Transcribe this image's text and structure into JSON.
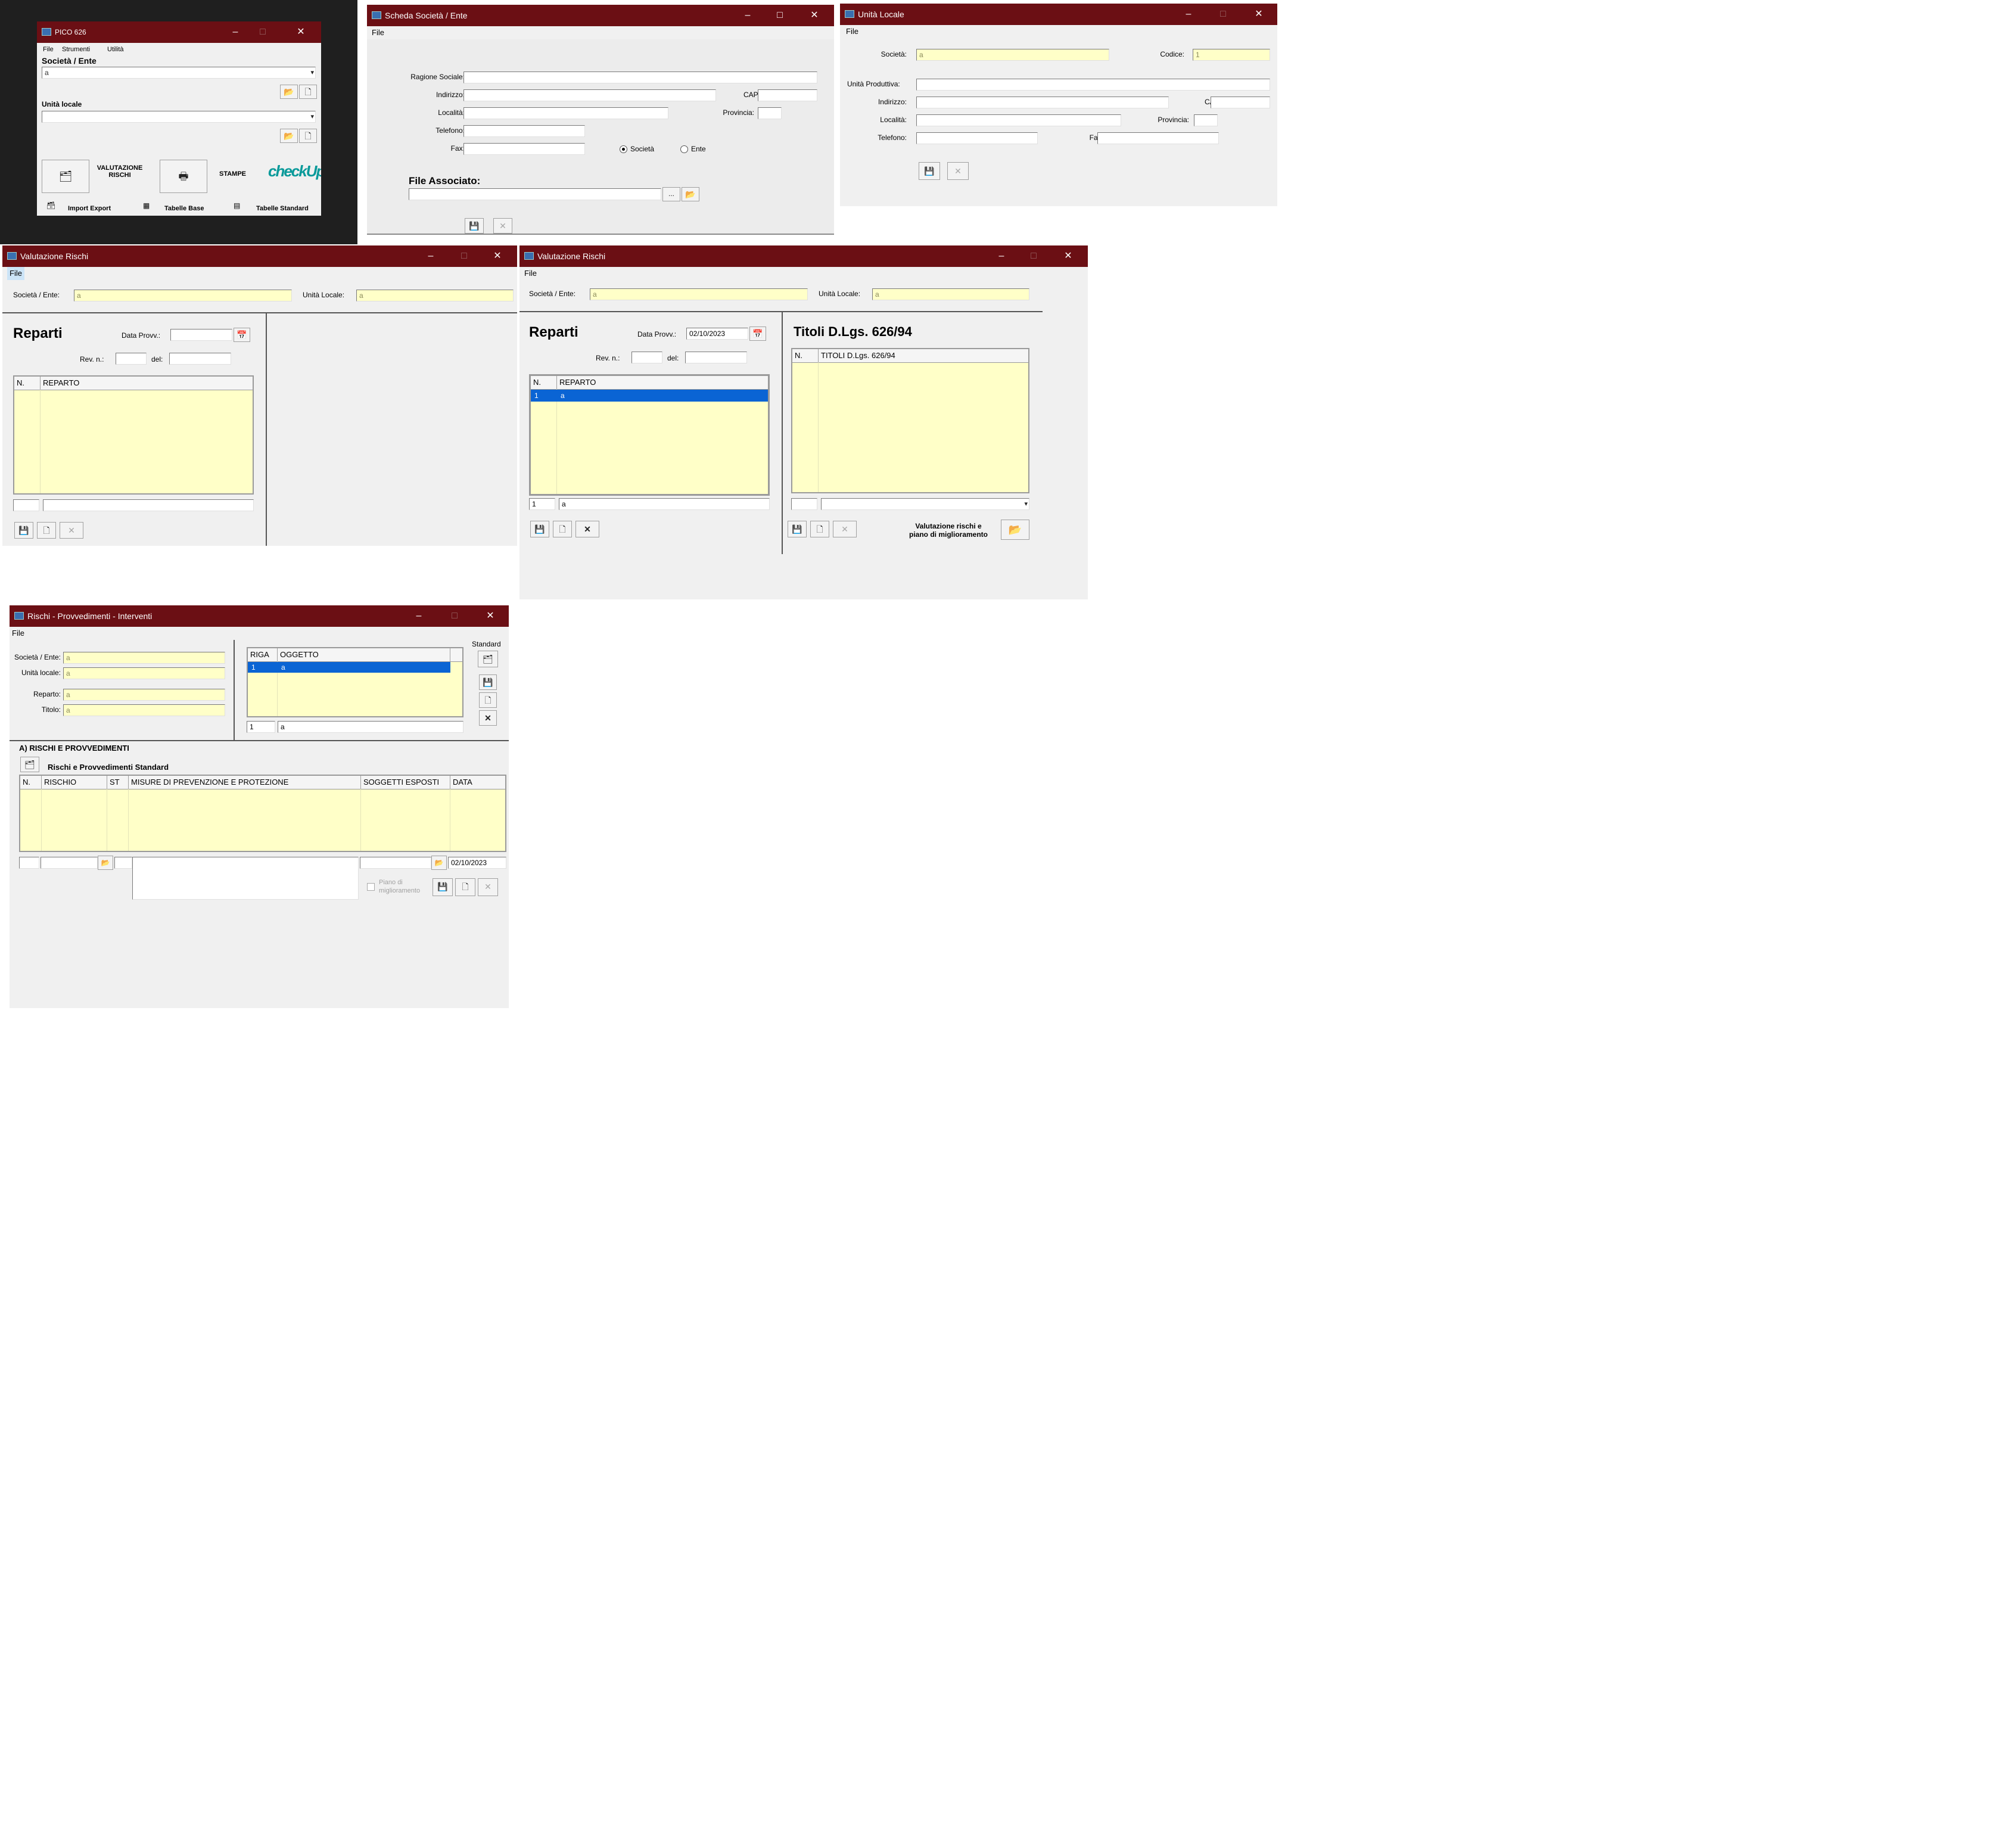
{
  "pico": {
    "title": "PICO 626",
    "menu": [
      "File",
      "Strumenti",
      "Utilità"
    ],
    "societa_label": "Società / Ente",
    "societa_value": "a",
    "unita_label": "Unità locale",
    "unita_value": "",
    "valutazione_label": "VALUTAZIONE\nRISCHI",
    "stampe_label": "STAMPE",
    "logo_text": "checkUp",
    "import_export": "Import Export",
    "tabelle_base": "Tabelle Base",
    "tabelle_standard": "Tabelle Standard"
  },
  "scheda": {
    "title": "Scheda Società / Ente",
    "menu": "File",
    "ragione_sociale": "Ragione Sociale:",
    "indirizzo": "Indirizzo:",
    "cap": "CAP:",
    "localita": "Località:",
    "provincia": "Provincia:",
    "telefono": "Telefono:",
    "fax": "Fax:",
    "radio_societa": "Società",
    "radio_ente": "Ente",
    "file_associato": "File Associato:",
    "browse": "..."
  },
  "unita": {
    "title": "Unità Locale",
    "menu": "File",
    "societa": "Società:",
    "societa_value": "a",
    "codice": "Codice:",
    "codice_value": "1",
    "unita_produttiva": "Unità Produttiva:",
    "indirizzo": "Indirizzo:",
    "cap": "CAP:",
    "localita": "Località:",
    "provincia": "Provincia:",
    "telefono": "Telefono:",
    "fax": "Fax:"
  },
  "val1": {
    "title": "Valutazione Rischi",
    "menu": "File",
    "societa": "Società / Ente:",
    "societa_value": "a",
    "unita": "Unità Locale:",
    "unita_value": "a",
    "reparti": "Reparti",
    "data_provv": "Data Provv.:",
    "data_value": "",
    "rev": "Rev. n.:",
    "del": "del:",
    "col_n": "N.",
    "col_reparto": "REPARTO"
  },
  "val2": {
    "title": "Valutazione Rischi",
    "menu": "File",
    "societa": "Società / Ente:",
    "societa_value": "a",
    "unita": "Unità Locale:",
    "unita_value": "a",
    "reparti": "Reparti",
    "data_provv": "Data Provv.:",
    "data_value": "02/10/2023",
    "rev": "Rev. n.:",
    "del": "del:",
    "col_n": "N.",
    "col_reparto": "REPARTO",
    "row_n": "1",
    "row_reparto": "a",
    "edit_n": "1",
    "edit_reparto": "a",
    "titoli": "Titoli D.Lgs. 626/94",
    "col_titoli": "TITOLI D.Lgs. 626/94",
    "val_piano": "Valutazione rischi e\npiano di miglioramento"
  },
  "rischi": {
    "title": "Rischi - Provvedimenti - Interventi",
    "menu": "File",
    "societa": "Società / Ente:",
    "societa_value": "a",
    "unita": "Unità locale:",
    "unita_value": "a",
    "reparto": "Reparto:",
    "reparto_value": "a",
    "titolo": "Titolo:",
    "titolo_value": "a",
    "col_riga": "RIGA",
    "col_oggetto": "OGGETTO",
    "row_riga": "1",
    "row_oggetto": "a",
    "edit_riga": "1",
    "edit_oggetto": "a",
    "standard": "Standard",
    "section": "A) RISCHI E PROVVEDIMENTI",
    "rischi_std": "Rischi e Provvedimenti Standard",
    "col_n": "N.",
    "col_rischio": "RISCHIO",
    "col_st": "ST",
    "col_misure": "MISURE DI PREVENZIONE E PROTEZIONE",
    "col_soggetti": "SOGGETTI ESPOSTI",
    "col_data": "DATA",
    "data_value": "02/10/2023",
    "piano": "Piano di\nmiglioramento"
  }
}
